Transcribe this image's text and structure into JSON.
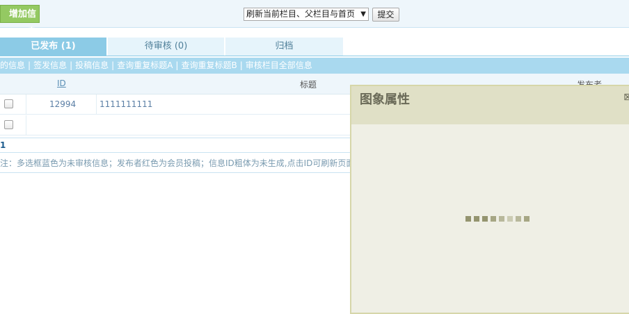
{
  "toolbar": {
    "add_label": "增加信息",
    "refresh_option": "刷新当前栏目、父栏目与首页",
    "submit_label": "提交"
  },
  "tabs": [
    {
      "label": "已发布 (1)"
    },
    {
      "label": "待审核 (0)"
    },
    {
      "label": "归档"
    }
  ],
  "links": [
    "的信息",
    "签发信息",
    "投稿信息",
    "查询重复标题A",
    "查询重复标题B",
    "审核栏目全部信息"
  ],
  "table": {
    "headers": {
      "id": "ID",
      "title": "标题",
      "publisher": "发布者"
    },
    "rows": [
      {
        "id": "12994",
        "title": "1111111111"
      }
    ]
  },
  "pager": {
    "page": "1"
  },
  "note": "注：多选框蓝色为未审核信息；发布者红色为会员投稿；信息ID粗体为未生成,点击ID可刷新页面",
  "dialog": {
    "title": "图象属性",
    "close": "⊠",
    "loader_colors": [
      "#94946f",
      "#94946f",
      "#94946f",
      "#a6a684",
      "#b8b89b",
      "#cbcbb3",
      "#b8b89b",
      "#a6a684"
    ]
  }
}
